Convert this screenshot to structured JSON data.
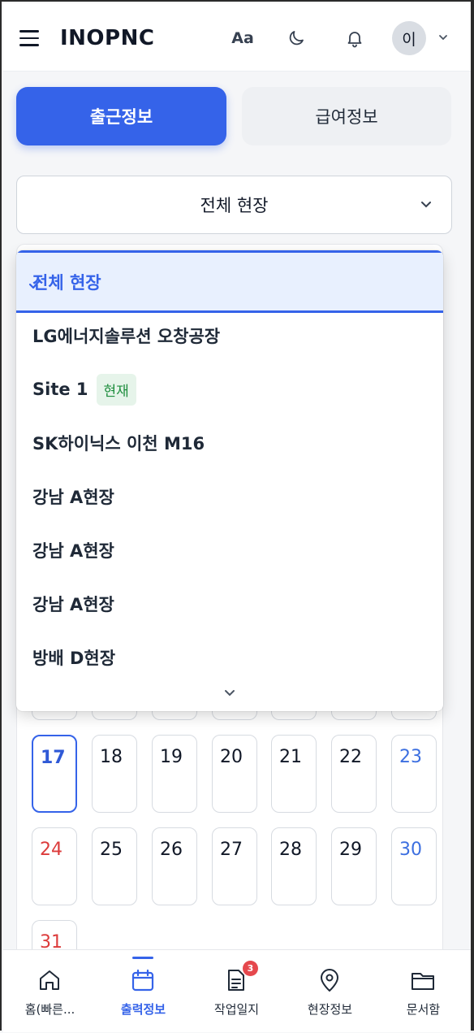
{
  "header": {
    "title": "INOPNC",
    "font_size_label": "Aa",
    "avatar_initial": "이",
    "icons": [
      "menu-icon",
      "font-size-icon",
      "moon-icon",
      "bell-icon",
      "chevron-down-icon"
    ]
  },
  "tabs": [
    {
      "label": "출근정보",
      "active": true
    },
    {
      "label": "급여정보",
      "active": false
    }
  ],
  "site_select": {
    "value": "전체 현장"
  },
  "site_dropdown": {
    "options": [
      {
        "label": "전체 현장",
        "selected": true
      },
      {
        "label": "LG에너지솔루션 오창공장"
      },
      {
        "label": "Site 1",
        "badge": "현재"
      },
      {
        "label": "SK하이닉스 이천 M16"
      },
      {
        "label": "강남 A현장"
      },
      {
        "label": "강남 A현장"
      },
      {
        "label": "강남 A현장"
      },
      {
        "label": "방배 D현장"
      }
    ]
  },
  "calendar": {
    "weeks": [
      [
        "17",
        "18",
        "19",
        "20",
        "21",
        "22",
        "23"
      ],
      [
        "24",
        "25",
        "26",
        "27",
        "28",
        "29",
        "30"
      ],
      [
        "31"
      ]
    ],
    "today": "17",
    "colors": {
      "sunday": "#dc3b3b",
      "saturday": "#3c6fe0",
      "today": "#3563e9"
    }
  },
  "bottom_nav": [
    {
      "label": "홈(빠른...",
      "icon": "home-icon"
    },
    {
      "label": "출력정보",
      "icon": "calendar-icon",
      "active": true
    },
    {
      "label": "작업일지",
      "icon": "document-icon",
      "badge": "3"
    },
    {
      "label": "현장정보",
      "icon": "map-pin-icon"
    },
    {
      "label": "문서함",
      "icon": "folder-icon"
    }
  ],
  "colors": {
    "accent": "#3563e9",
    "badge_green": "#1e8e3e",
    "notification": "#e5484d"
  }
}
